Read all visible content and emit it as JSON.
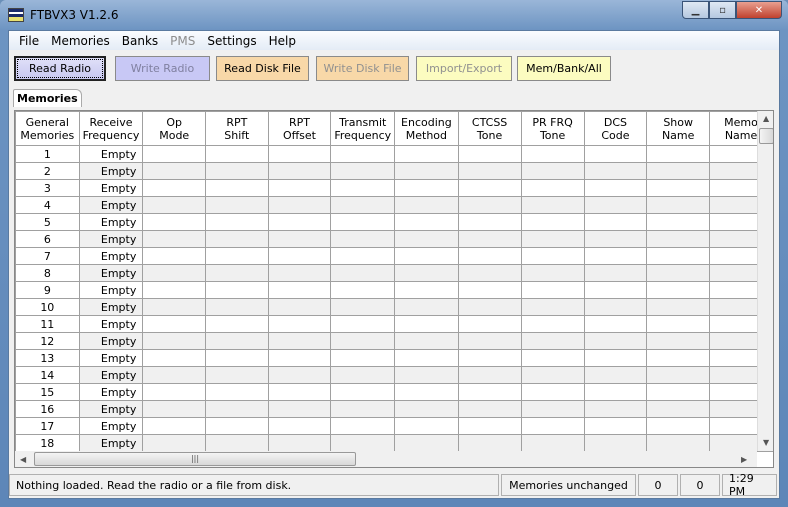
{
  "window": {
    "title": "FTBVX3 V1.2.6"
  },
  "menu": [
    "File",
    "Memories",
    "Banks",
    "PMS",
    "Settings",
    "Help"
  ],
  "toolbar": {
    "read_radio": "Read Radio",
    "write_radio": "Write Radio",
    "read_disk": "Read Disk File",
    "write_disk": "Write Disk File",
    "import_export": "Import/Export",
    "mem_bank_all": "Mem/Bank/All"
  },
  "colors": {
    "write_radio": "#c8c8f5",
    "disk": "#f8d8a8",
    "import": "#fcfcc0"
  },
  "tab": "Memories",
  "grid": {
    "headers": [
      [
        "General",
        "Memories"
      ],
      [
        "Receive",
        "Frequency"
      ],
      [
        "Op",
        "Mode"
      ],
      [
        "RPT",
        "Shift"
      ],
      [
        "RPT",
        "Offset"
      ],
      [
        "Transmit",
        "Frequency"
      ],
      [
        "Encoding",
        "Method"
      ],
      [
        "CTCSS",
        "Tone"
      ],
      [
        "PR FRQ",
        "Tone"
      ],
      [
        "DCS",
        "Code"
      ],
      [
        "Show",
        "Name"
      ],
      [
        "Memo",
        "Name"
      ]
    ],
    "rows": [
      "1",
      "2",
      "3",
      "4",
      "5",
      "6",
      "7",
      "8",
      "9",
      "10",
      "11",
      "12",
      "13",
      "14",
      "15",
      "16",
      "17",
      "18"
    ],
    "empty_label": "Empty"
  },
  "status": {
    "message": "Nothing loaded. Read the radio or a file from disk.",
    "state": "Memories unchanged",
    "count1": "0",
    "count2": "0",
    "time": "1:29 PM"
  }
}
